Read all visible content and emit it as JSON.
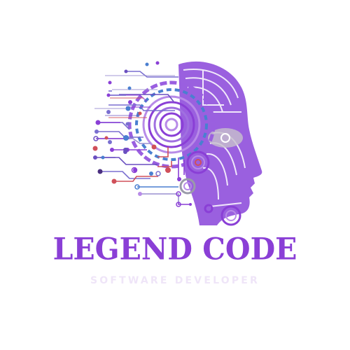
{
  "logo": {
    "title": "LEGEND CODE",
    "subtitle": "SOFTWARE DEVELOPER",
    "emblem_icon": "circuit-ai-head-icon"
  },
  "colors": {
    "primary": "#8a3fd6",
    "light_purple": "#b88be8",
    "blue": "#4a7fd0",
    "red": "#d0505a",
    "subtitle": "#efe5f8"
  }
}
